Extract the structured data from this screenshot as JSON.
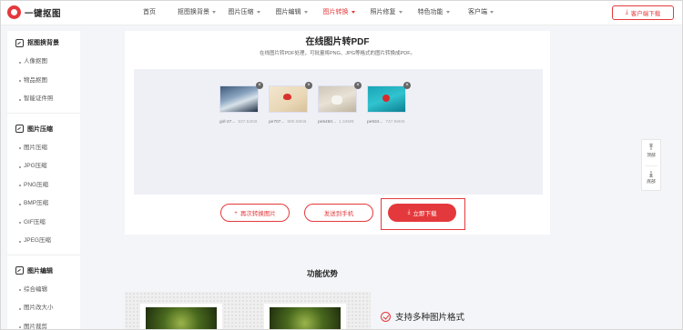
{
  "brand": {
    "name": "一键抠图"
  },
  "nav": {
    "items": [
      {
        "label": "首页",
        "caret": false,
        "active": false
      },
      {
        "label": "抠图换背景",
        "caret": true,
        "active": false
      },
      {
        "label": "图片压缩",
        "caret": true,
        "active": false
      },
      {
        "label": "图片编辑",
        "caret": true,
        "active": false
      },
      {
        "label": "图片转换",
        "caret": true,
        "active": true
      },
      {
        "label": "照片修复",
        "caret": true,
        "active": false
      },
      {
        "label": "特色功能",
        "caret": true,
        "active": false
      },
      {
        "label": "客户端",
        "caret": true,
        "active": false
      }
    ],
    "client_download": "客户端下载"
  },
  "sidebar": {
    "groups": [
      {
        "title": "抠图换背景",
        "items": [
          "人像抠图",
          "物品抠图",
          "智能证件照"
        ]
      },
      {
        "title": "图片压缩",
        "items": [
          "图片压缩",
          "JPG压缩",
          "PNG压缩",
          "BMP压缩",
          "GIF压缩",
          "JPEG压缩"
        ]
      },
      {
        "title": "图片编辑",
        "items": [
          "综合编辑",
          "图片改大小",
          "图片裁剪"
        ]
      }
    ]
  },
  "main": {
    "title": "在线图片转PDF",
    "subtitle": "在线图片转PDF处理，可批量将PNG、JPG等格式的图片转换成PDF。",
    "files": [
      {
        "name": "girl-27...",
        "size": "937.52KB"
      },
      {
        "name": "pe707...",
        "size": "900.08KB"
      },
      {
        "name": "pe5450...",
        "size": "1.34MB"
      },
      {
        "name": "pe934...",
        "size": "747.96KB"
      }
    ],
    "buttons": {
      "reconvert": "再次转换图片",
      "send_phone": "发送到手机",
      "download_now": "立即下载"
    }
  },
  "float_panel": {
    "top": "顶部",
    "bottom": "底部"
  },
  "advantages": {
    "title": "功能优势",
    "feature1": "支持多种图片格式"
  },
  "colors": {
    "accent": "#e4393c"
  }
}
